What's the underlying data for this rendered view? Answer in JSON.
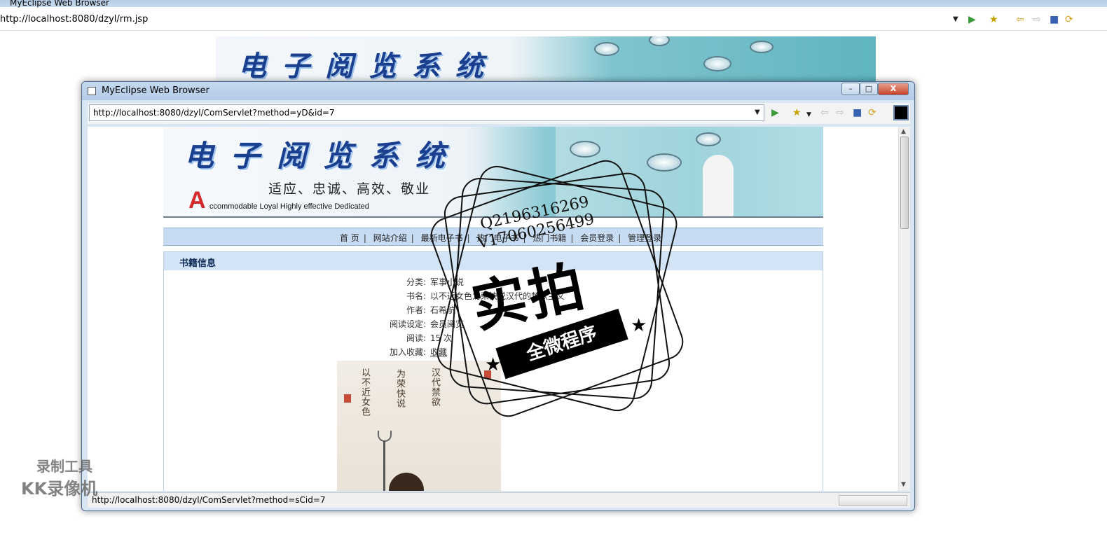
{
  "outer_browser": {
    "title": "MyEclipse Web Browser",
    "url": "http://localhost:8080/dzyl/rm.jsp",
    "banner_title": "电子阅览系统"
  },
  "inner_browser": {
    "title": "MyEclipse Web Browser",
    "url": "http://localhost:8080/dzyl/ComServlet?method=yD&id=7",
    "status_text": "http://localhost:8080/dzyl/ComServlet?method=sCid=7",
    "window_buttons": {
      "minimize": "–",
      "maximize": "□",
      "close": "X"
    }
  },
  "toolbar_icons": [
    "go-icon",
    "favorites-icon",
    "back-icon",
    "forward-icon",
    "stop-icon",
    "refresh-icon"
  ],
  "page": {
    "banner": {
      "title": "电子阅览系统",
      "slogan": "适应、忠诚、高效、敬业",
      "logo_letter": "A",
      "english": "ccommodable  Loyal  Highly effective  Dedicated"
    },
    "nav": [
      "首 页",
      "网站介绍",
      "最新电子书",
      "热门电子书",
      "热门书籍",
      "会员登录",
      "管理登录"
    ],
    "info": {
      "title": "书籍信息",
      "rows": [
        {
          "label": "分类:",
          "value": "军事小说"
        },
        {
          "label": "书名:",
          "value": "以不近女色为荣快说汉代的禁欲主义"
        },
        {
          "label": "作者:",
          "value": "石希航"
        },
        {
          "label": "阅读设定:",
          "value": "会员阅览"
        },
        {
          "label": "阅读:",
          "value": "15 次"
        },
        {
          "label": "加入收藏:",
          "value": "收藏"
        }
      ]
    }
  },
  "watermark": {
    "qq": "Q2196316269",
    "vx": "V17060256499",
    "main": "实拍",
    "ribbon": "全微程序",
    "recorder_line1": "录制工具",
    "recorder_line2": "KK录像机"
  },
  "colors": {
    "nav_bg": "#c7dcf3",
    "panel_header_bg": "#d3e4f7",
    "title_blue": "#1a3f8f",
    "logo_red": "#d42a2a"
  }
}
